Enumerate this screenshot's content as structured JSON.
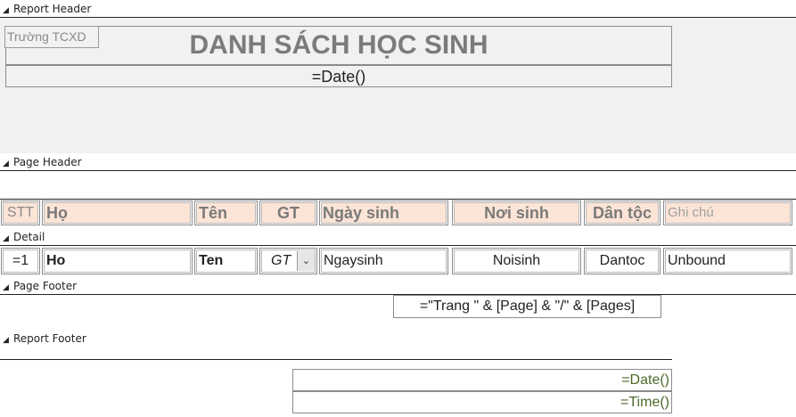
{
  "bands": {
    "report_header": "Report Header",
    "page_header": "Page Header",
    "detail": "Detail",
    "page_footer": "Page Footer",
    "report_footer": "Report Footer"
  },
  "report_header": {
    "school_label": "Trường TCXD",
    "title": "DANH SÁCH HỌC SINH",
    "date_expr": "=Date()"
  },
  "columns": [
    {
      "header": "STT",
      "field": "=1"
    },
    {
      "header": "Họ",
      "field": "Ho"
    },
    {
      "header": "Tên",
      "field": "Ten"
    },
    {
      "header": "GT",
      "field": "GT"
    },
    {
      "header": "Ngày sinh",
      "field": "Ngaysinh"
    },
    {
      "header": "Nơi sinh",
      "field": "Noisinh"
    },
    {
      "header": "Dân tộc",
      "field": "Dantoc"
    },
    {
      "header": "Ghi  chú",
      "field": "Unbound"
    }
  ],
  "page_footer": {
    "page_expr": "=\"Trang \" & [Page] & \"/\" & [Pages]"
  },
  "report_footer": {
    "date_expr": "=Date()",
    "time_expr": "=Time()"
  },
  "colors": {
    "header_fill": "#fce4d6",
    "section_gray": "#f1f1f1",
    "expr_green": "#4b6a2a"
  },
  "icons": {
    "band_marker": "band-arrow-icon",
    "combo_dropdown": "chevron-down-icon"
  }
}
